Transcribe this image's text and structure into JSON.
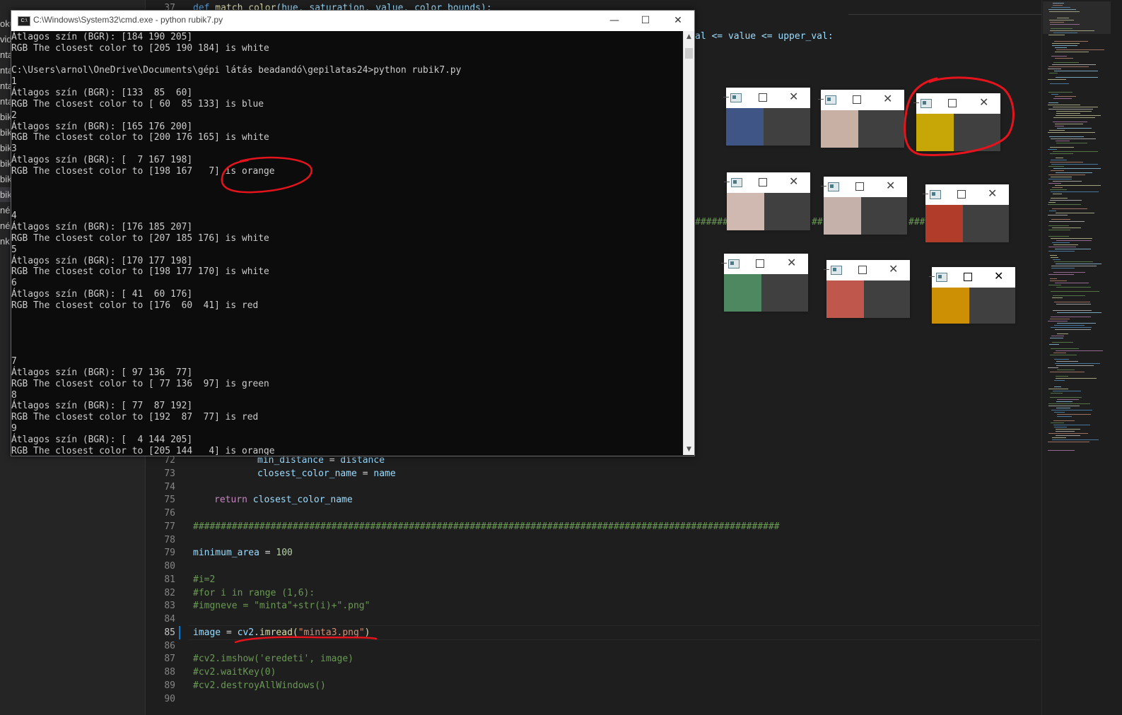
{
  "cmd": {
    "title": "C:\\Windows\\System32\\cmd.exe - python  rubik7.py",
    "icon": "C:\\",
    "minimize": "—",
    "maximize": "☐",
    "close": "✕",
    "lines": [
      "Átlagos szín (BGR): [184 190 205]",
      "RGB The closest color to [205 190 184] is white",
      "",
      "C:\\Users\\arnol\\OneDrive\\Documents\\gépi látás beadandó\\gepilatas24>python rubik7.py",
      "1",
      "Átlagos szín (BGR): [133  85  60]",
      "RGB The closest color to [ 60  85 133] is blue",
      "2",
      "Átlagos szín (BGR): [165 176 200]",
      "RGB The closest color to [200 176 165] is white",
      "3",
      "Átlagos szín (BGR): [  7 167 198]",
      "RGB The closest color to [198 167   7] is orange",
      "",
      "",
      "",
      "4",
      "Átlagos szín (BGR): [176 185 207]",
      "RGB The closest color to [207 185 176] is white",
      "5",
      "Átlagos szín (BGR): [170 177 198]",
      "RGB The closest color to [198 177 170] is white",
      "6",
      "Átlagos szín (BGR): [ 41  60 176]",
      "RGB The closest color to [176  60  41] is red",
      "",
      "",
      "",
      "",
      "7",
      "Átlagos szín (BGR): [ 97 136  77]",
      "RGB The closest color to [ 77 136  97] is green",
      "8",
      "Átlagos szín (BGR): [ 77  87 192]",
      "RGB The closest color to [192  87  77] is red",
      "9",
      "Átlagos szín (BGR): [  4 144 205]",
      "RGB The closest color to [205 144   4] is orange"
    ]
  },
  "editor": {
    "top_line": {
      "num": "37",
      "text": "def match_color(hue, saturation, value, color_bounds):"
    },
    "hidden_line_fragment": "al <= value <= upper_val:",
    "hash_fragment_left": "#########",
    "hash_fragment_mid": "##",
    "hash_fragment_right": "###",
    "lines": [
      {
        "num": "72",
        "text": "min_distance = distance"
      },
      {
        "num": "73",
        "text": "closest_color_name = name"
      },
      {
        "num": "74",
        "text": ""
      },
      {
        "num": "75",
        "text": "return closest_color_name"
      },
      {
        "num": "76",
        "text": ""
      },
      {
        "num": "77",
        "text": "##########################################################################################################"
      },
      {
        "num": "78",
        "text": ""
      },
      {
        "num": "79",
        "text": "minimum_area = 100"
      },
      {
        "num": "80",
        "text": ""
      },
      {
        "num": "81",
        "text": "#i=2"
      },
      {
        "num": "82",
        "text": "#for i in range (1,6):"
      },
      {
        "num": "83",
        "text": "#imgneve = \"minta\"+str(i)+\".png\""
      },
      {
        "num": "84",
        "text": ""
      },
      {
        "num": "85",
        "text": "image = cv2.imread(\"minta3.png\")"
      },
      {
        "num": "86",
        "text": ""
      },
      {
        "num": "87",
        "text": "#cv2.imshow('eredeti', image)"
      },
      {
        "num": "88",
        "text": "#cv2.waitKey(0)"
      },
      {
        "num": "89",
        "text": "#cv2.destroyAllWindows()"
      },
      {
        "num": "90",
        "text": ""
      }
    ],
    "tokens": {
      "l72_a": "min_distance",
      "l72_b": " = ",
      "l72_c": "distance",
      "l73_a": "closest_color_name",
      "l73_b": " = ",
      "l73_c": "name",
      "l75_a": "return",
      "l75_b": " ",
      "l75_c": "closest_color_name",
      "l79_a": "minimum_area",
      "l79_b": " = ",
      "l79_c": "100",
      "l85_a": "image",
      "l85_b": " = ",
      "l85_c": "cv2",
      "l85_d": ".",
      "l85_e": "imread",
      "l85_f": "(",
      "l85_g": "\"minta3.png\"",
      "l85_h": ")",
      "l37_a": "def",
      "l37_b": " match_color",
      "l37_c": "(hue, saturation, value, color_bounds):"
    }
  },
  "left_strip_fragments": [
    "oku",
    "vid",
    "nta",
    "nta",
    "nta",
    "nta",
    "bik",
    "bik",
    "bik",
    "bik",
    "bik",
    "bik",
    "né",
    "né",
    "nk"
  ],
  "color_windows": [
    {
      "name": "window-1",
      "swatch": "#3f5585",
      "maximize": "☐",
      "close": "✕"
    },
    {
      "name": "window-2",
      "swatch": "#c8b0a5",
      "maximize": "☐",
      "close": "✕"
    },
    {
      "name": "window-3",
      "swatch": "#c6a707",
      "maximize": "☐",
      "close": "✕"
    },
    {
      "name": "window-4",
      "swatch": "#cfb9b0",
      "maximize": "☐",
      "close": "✕"
    },
    {
      "name": "window-5",
      "swatch": "#c6b1aa",
      "maximize": "☐",
      "close": "✕"
    },
    {
      "name": "window-6",
      "swatch": "#b03c29",
      "maximize": "☐",
      "close": "✕"
    },
    {
      "name": "window-7",
      "swatch": "#4d8861",
      "maximize": "☐",
      "close": "✕"
    },
    {
      "name": "window-8",
      "swatch": "#c0574d",
      "maximize": "☐",
      "close": "✕"
    },
    {
      "name": "window-9",
      "swatch": "#cd9004",
      "maximize": "☐",
      "close": "✕"
    }
  ],
  "colors": {
    "annotation_red": "#e5141c",
    "console_bg": "#0c0c0c",
    "editor_bg": "#1e1e1e"
  }
}
